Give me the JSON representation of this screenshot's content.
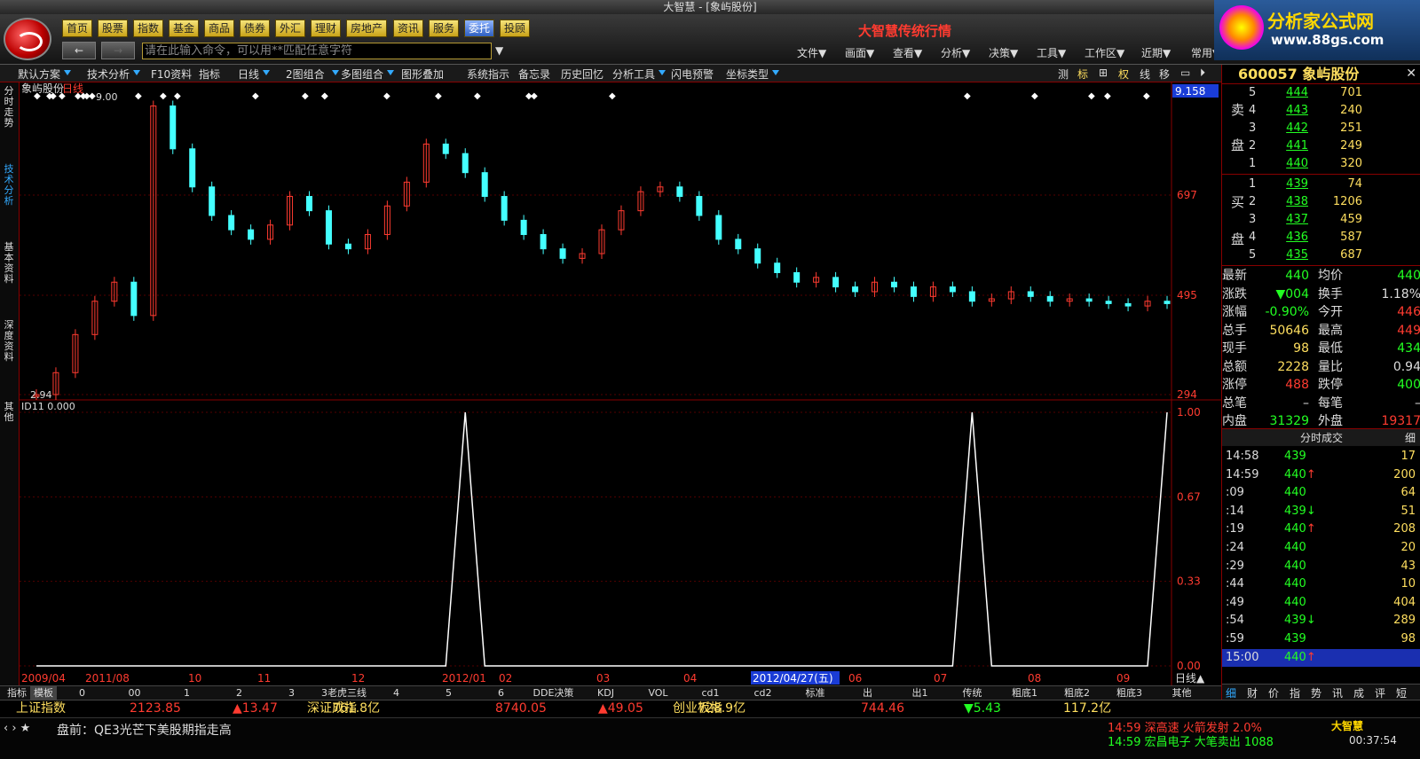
{
  "window": {
    "title": "大智慧 - [象屿股份]"
  },
  "toolbar": {
    "nav": [
      "首页",
      "股票",
      "指数",
      "基金",
      "商品",
      "债券",
      "外汇",
      "理财",
      "房地产",
      "资讯",
      "服务",
      "委托",
      "投顾"
    ],
    "active_nav": "委托",
    "command_placeholder": "请在此输入命令，可以用**匹配任意字符",
    "back": "←",
    "forward": "→",
    "menus": [
      "文件▼",
      "画面▼",
      "查看▼",
      "分析▼",
      "决策▼",
      "工具▼",
      "工作区▼",
      "近期▼",
      "常用▼"
    ],
    "brand": "大智慧传统行情"
  },
  "ad": {
    "title": "分析家公式网",
    "url": "www.88gs.com"
  },
  "subbar": {
    "items": [
      "默认方案",
      "技术分析",
      "F10资料",
      "指标",
      "日线",
      "2图组合",
      "多图组合",
      "图形叠加",
      "系统指示",
      "备忘录",
      "历史回忆",
      "分析工具",
      "闪电预警",
      "坐标类型"
    ],
    "right": [
      "测",
      "标",
      "⊞",
      "权",
      "线",
      "移",
      "▭",
      "⏵"
    ]
  },
  "sidetabs": [
    "分时走势",
    "技术分析",
    "基本资料",
    "深度资料",
    "其他"
  ],
  "chart": {
    "stock_label": "象屿股份",
    "period_label": "日线",
    "price_ticks": [
      "697",
      "495",
      "294"
    ],
    "current_price_tag": "9.158",
    "max_label": "9.00",
    "min_label": "2.94",
    "indicator_label": "ID11  0.000",
    "indicator_ticks": [
      "1.00",
      "0.67",
      "0.33",
      "0.00"
    ],
    "date_labels": [
      "2009/04",
      "2011/08",
      "10",
      "11",
      "12",
      "2012/01",
      "02",
      "03",
      "04",
      "2012/04/27(五)",
      "06",
      "07",
      "08",
      "09"
    ],
    "period_btn": "日线▲"
  },
  "chart_data": {
    "type": "line",
    "title": "象屿股份 日线",
    "series": [
      {
        "name": "象屿股份",
        "values": [
          2.94,
          3.4,
          4.2,
          4.9,
          5.3,
          4.6,
          9.0,
          8.1,
          7.3,
          6.7,
          6.4,
          6.2,
          6.5,
          7.1,
          6.8,
          6.1,
          6.0,
          6.3,
          6.9,
          7.4,
          8.2,
          8.0,
          7.6,
          7.1,
          6.6,
          6.3,
          6.0,
          5.8,
          5.9,
          6.4,
          6.8,
          7.2,
          7.3,
          7.1,
          6.7,
          6.2,
          6.0,
          5.7,
          5.5,
          5.3,
          5.4,
          5.2,
          5.1,
          5.3,
          5.2,
          5.0,
          5.2,
          5.1,
          4.9,
          4.95,
          5.1,
          5.0,
          4.9,
          4.95,
          4.9,
          4.85,
          4.8,
          4.9,
          4.85
        ]
      },
      {
        "name": "ID11",
        "values": [
          0,
          0,
          0,
          0,
          0,
          0,
          0,
          0,
          0,
          0,
          0,
          0,
          0,
          0,
          0,
          0,
          0,
          0,
          0,
          0,
          0,
          0,
          1,
          0,
          0,
          0,
          0,
          0,
          0,
          0,
          0,
          0,
          0,
          0,
          0,
          0,
          0,
          0,
          0,
          0,
          0,
          0,
          0,
          0,
          0,
          0,
          0,
          0,
          1,
          0,
          0,
          0,
          0,
          0,
          0,
          0,
          0,
          0,
          1
        ]
      }
    ],
    "ylim": [
      2.94,
      9.158
    ],
    "indicator_ylim": [
      0,
      1
    ]
  },
  "bottomlabels": [
    "指标",
    "模板",
    "0",
    "00",
    "1",
    "2",
    "3",
    "3老虎三线",
    "4",
    "5",
    "6",
    "DDE决策",
    "KDJ",
    "VOL",
    "cd1",
    "cd2",
    "标准",
    "出",
    "出1",
    "传统",
    "粗底1",
    "粗底2",
    "粗底3",
    "其他"
  ],
  "quote": {
    "code": "600057",
    "name": "象屿股份",
    "sell_label": [
      "卖",
      "盘"
    ],
    "buy_label": [
      "买",
      "盘"
    ],
    "asks": [
      {
        "lvl": "5",
        "price": "444",
        "vol": "701"
      },
      {
        "lvl": "4",
        "price": "443",
        "vol": "240"
      },
      {
        "lvl": "3",
        "price": "442",
        "vol": "251"
      },
      {
        "lvl": "2",
        "price": "441",
        "vol": "249"
      },
      {
        "lvl": "1",
        "price": "440",
        "vol": "320"
      }
    ],
    "bids": [
      {
        "lvl": "1",
        "price": "439",
        "vol": "74"
      },
      {
        "lvl": "2",
        "price": "438",
        "vol": "1206"
      },
      {
        "lvl": "3",
        "price": "437",
        "vol": "459"
      },
      {
        "lvl": "4",
        "price": "436",
        "vol": "587"
      },
      {
        "lvl": "5",
        "price": "435",
        "vol": "687"
      }
    ],
    "stats": [
      {
        "l": "最新",
        "v": "440",
        "vc": "g",
        "l2": "均价",
        "v2": "440",
        "v2c": "g"
      },
      {
        "l": "涨跌",
        "v": "▼004",
        "vc": "g",
        "l2": "换手",
        "v2": "1.18%",
        "v2c": "w"
      },
      {
        "l": "涨幅",
        "v": "-0.90%",
        "vc": "g",
        "l2": "今开",
        "v2": "446",
        "v2c": "r"
      },
      {
        "l": "总手",
        "v": "50646",
        "vc": "y",
        "l2": "最高",
        "v2": "449",
        "v2c": "r"
      },
      {
        "l": "现手",
        "v": "98",
        "vc": "y",
        "l2": "最低",
        "v2": "434",
        "v2c": "g"
      },
      {
        "l": "总额",
        "v": "2228",
        "vc": "y",
        "l2": "量比",
        "v2": "0.94",
        "v2c": "w"
      },
      {
        "l": "涨停",
        "v": "488",
        "vc": "r",
        "l2": "跌停",
        "v2": "400",
        "v2c": "g"
      },
      {
        "l": "总笔",
        "v": "–",
        "vc": "w",
        "l2": "每笔",
        "v2": "–",
        "v2c": "w"
      },
      {
        "l": "内盘",
        "v": "31329",
        "vc": "g",
        "l2": "外盘",
        "v2": "19317",
        "v2c": "r"
      }
    ],
    "trades_title": "分时成交",
    "trades_more": "细",
    "trades": [
      {
        "t": "14:58",
        "p": "439",
        "a": "",
        "v": "17"
      },
      {
        "t": "14:59",
        "p": "440",
        "a": "↑",
        "v": "200"
      },
      {
        "t": ":09",
        "p": "440",
        "a": "",
        "v": "64"
      },
      {
        "t": ":14",
        "p": "439",
        "a": "↓",
        "v": "51"
      },
      {
        "t": ":19",
        "p": "440",
        "a": "↑",
        "v": "208"
      },
      {
        "t": ":24",
        "p": "440",
        "a": "",
        "v": "20"
      },
      {
        "t": ":29",
        "p": "440",
        "a": "",
        "v": "43"
      },
      {
        "t": ":44",
        "p": "440",
        "a": "",
        "v": "10"
      },
      {
        "t": ":49",
        "p": "440",
        "a": "",
        "v": "404"
      },
      {
        "t": ":54",
        "p": "439",
        "a": "↓",
        "v": "289"
      },
      {
        "t": ":59",
        "p": "439",
        "a": "",
        "v": "98"
      },
      {
        "t": "15:00",
        "p": "440",
        "a": "↑",
        "v": ""
      }
    ],
    "tabs": [
      "细",
      "财",
      "价",
      "指",
      "势",
      "讯",
      "成",
      "评",
      "短"
    ]
  },
  "indexbar": [
    {
      "name": "上证指数",
      "value": "2123.85",
      "chg": "▲13.47",
      "amt": "761.8亿"
    },
    {
      "name": "深证成指",
      "value": "8740.05",
      "chg": "▲49.05",
      "amt": "728.9亿"
    },
    {
      "name": "创业板指",
      "value": "744.46",
      "chg": "▼5.43",
      "amt": "117.2亿"
    }
  ],
  "status": {
    "ticker": "盘前：QE3光芒下美股期指走高",
    "alert1": "14:59 深高速  火箭发射 2.0%",
    "alert2": "14:59 宏昌电子 大笔卖出 1088",
    "app": "大智慧",
    "clock": "00:37:54"
  }
}
